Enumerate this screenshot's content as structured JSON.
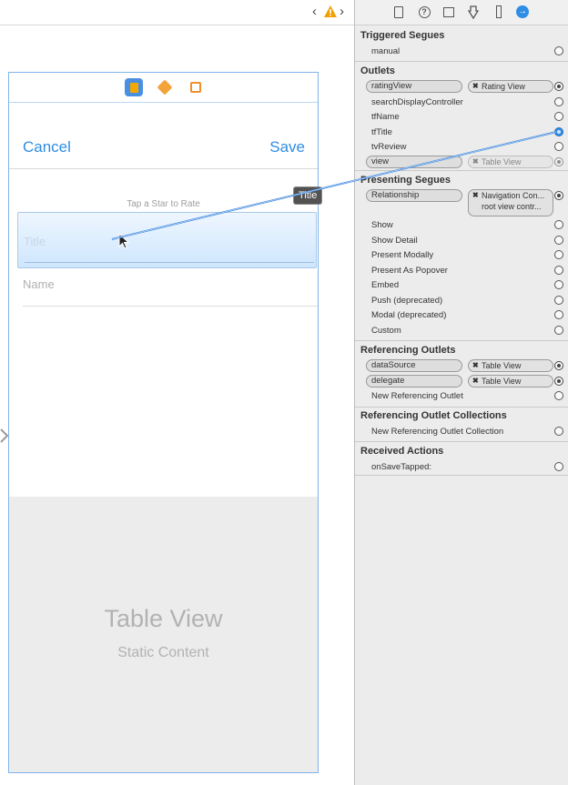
{
  "toolbar": {
    "back": "‹",
    "forward": "›"
  },
  "scene": {
    "cancel": "Cancel",
    "save": "Save",
    "rate_label": "Tap a Star to Rate",
    "title_placeholder": "Title",
    "name_placeholder": "Name",
    "tooltip": "Title",
    "table_view_title": "Table View",
    "table_view_sub": "Static Content"
  },
  "panel": {
    "triggered_segues": {
      "header": "Triggered Segues",
      "rows": [
        {
          "label": "manual"
        }
      ]
    },
    "outlets": {
      "header": "Outlets",
      "rows": [
        {
          "label": "ratingView",
          "target": "Rating View"
        },
        {
          "label": "searchDisplayController"
        },
        {
          "label": "tfName"
        },
        {
          "label": "tfTitle"
        },
        {
          "label": "tvReview"
        },
        {
          "label": "view",
          "target": "Table View"
        }
      ]
    },
    "presenting_segues": {
      "header": "Presenting Segues",
      "relationship": {
        "label": "Relationship",
        "target": "Navigation Con...",
        "target2": "root view contr..."
      },
      "rows": [
        {
          "label": "Show"
        },
        {
          "label": "Show Detail"
        },
        {
          "label": "Present Modally"
        },
        {
          "label": "Present As Popover"
        },
        {
          "label": "Embed"
        },
        {
          "label": "Push (deprecated)"
        },
        {
          "label": "Modal (deprecated)"
        },
        {
          "label": "Custom"
        }
      ]
    },
    "referencing_outlets": {
      "header": "Referencing Outlets",
      "rows": [
        {
          "label": "dataSource",
          "target": "Table View"
        },
        {
          "label": "delegate",
          "target": "Table View"
        },
        {
          "label": "New Referencing Outlet"
        }
      ]
    },
    "referencing_collections": {
      "header": "Referencing Outlet Collections",
      "rows": [
        {
          "label": "New Referencing Outlet Collection"
        }
      ]
    },
    "received_actions": {
      "header": "Received Actions",
      "rows": [
        {
          "label": "onSaveTapped:"
        }
      ]
    }
  },
  "colors": {
    "accent": "#2f8de4",
    "warning": "#f0a000"
  }
}
